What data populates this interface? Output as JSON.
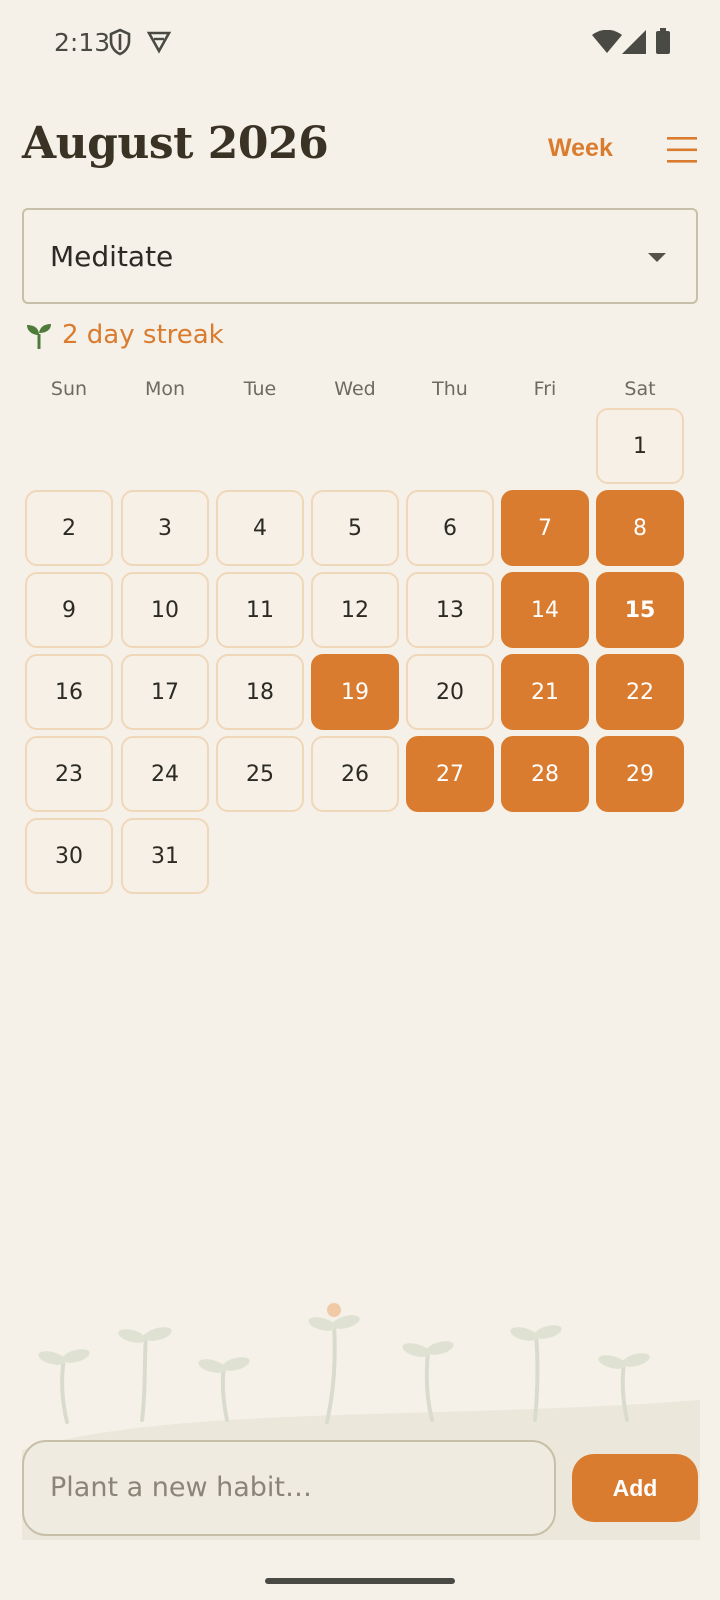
{
  "status_bar": {
    "time": "2:13",
    "icons": [
      "shield-icon",
      "vpn-icon",
      "wifi-icon",
      "signal-icon",
      "battery-icon"
    ]
  },
  "header": {
    "title": "August 2026",
    "view_toggle_label": "Week",
    "menu_icon": "hamburger-menu-icon"
  },
  "habit_selector": {
    "selected": "Meditate"
  },
  "streak": {
    "icon": "sprout-icon",
    "text": "2 day streak"
  },
  "calendar": {
    "weekdays": [
      "Sun",
      "Mon",
      "Tue",
      "Wed",
      "Thu",
      "Fri",
      "Sat"
    ],
    "first_weekday_index": 6,
    "days": [
      "1",
      "2",
      "3",
      "4",
      "5",
      "6",
      "7",
      "8",
      "9",
      "10",
      "11",
      "12",
      "13",
      "14",
      "15",
      "16",
      "17",
      "18",
      "19",
      "20",
      "21",
      "22",
      "23",
      "24",
      "25",
      "26",
      "27",
      "28",
      "29",
      "30",
      "31"
    ],
    "completed_days": [
      7,
      8,
      14,
      15,
      19,
      21,
      22,
      27,
      28,
      29
    ],
    "today": 15
  },
  "footer": {
    "input_placeholder": "Plant a new habit…",
    "add_label": "Add"
  },
  "colors": {
    "background": "#f5f1e8",
    "accent": "#d97c2f",
    "text": "#2b2a24",
    "day_border": "#f1d7b9",
    "field_border": "#c8bfa9"
  }
}
